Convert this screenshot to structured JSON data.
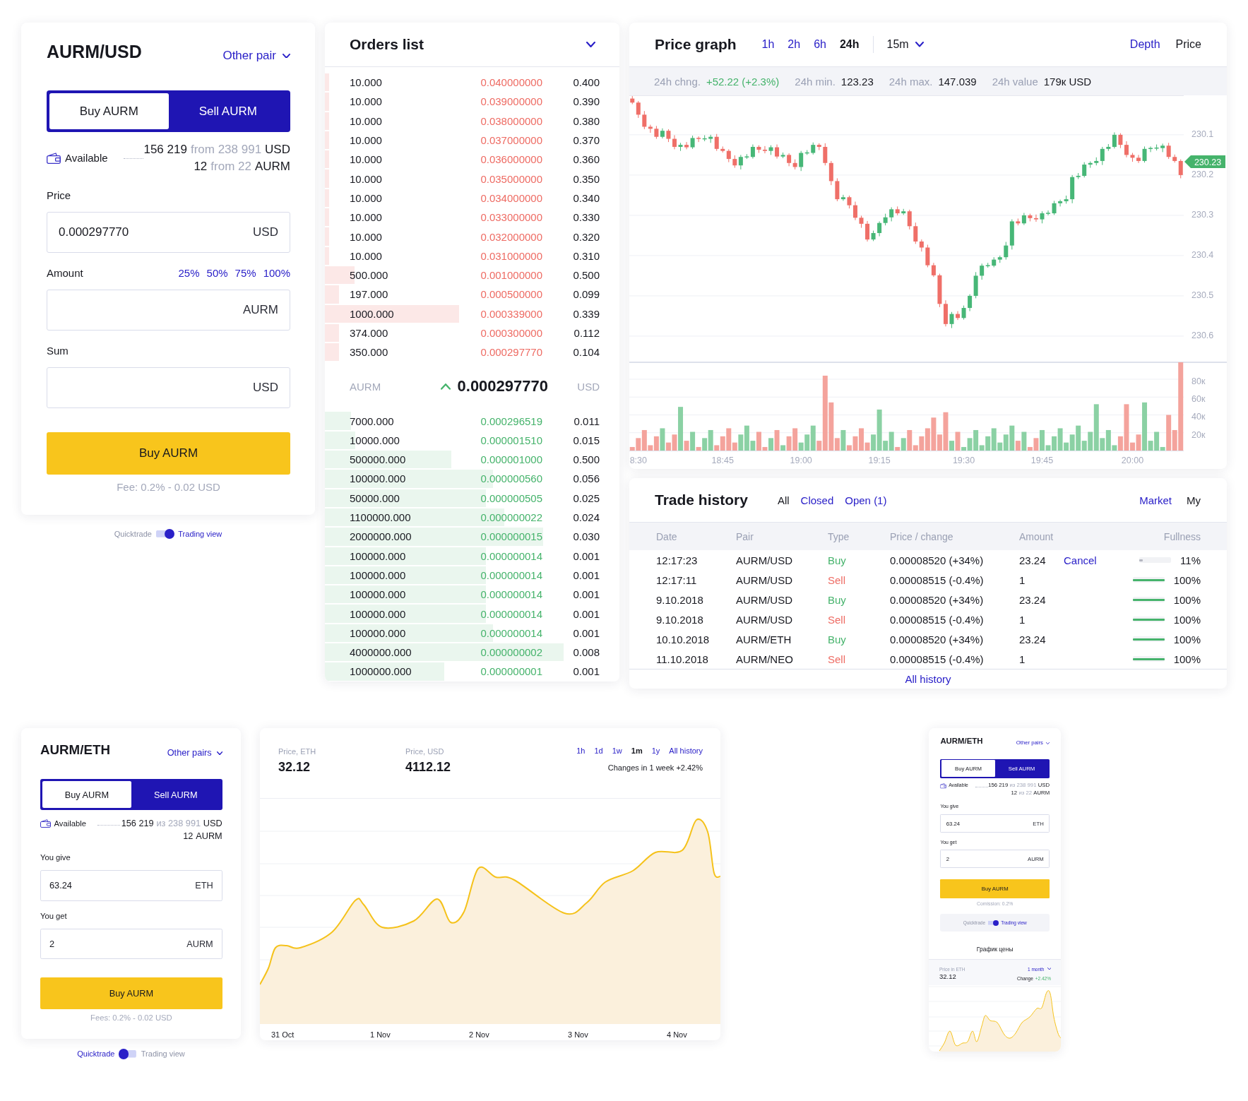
{
  "trade_panel": {
    "pair": "AURM/USD",
    "pair_menu": "Other pair",
    "tabs": [
      {
        "label": "Buy AURM",
        "selected": true
      },
      {
        "label": "Sell AURM",
        "selected": false
      }
    ],
    "available": {
      "label": "Available",
      "lines": [
        {
          "amount": "156 219",
          "of": "from 238 991",
          "unit": "USD"
        },
        {
          "amount": "12",
          "of": "from 22",
          "unit": "AURM"
        }
      ]
    },
    "fields": [
      {
        "label": "Price",
        "value": "0.000297770",
        "unit": "USD"
      },
      {
        "label": "Amount",
        "unit": "AURM",
        "shortcuts": [
          "25%",
          "50%",
          "75%",
          "100%"
        ]
      },
      {
        "label": "Sum",
        "unit": "USD"
      }
    ],
    "submit": "Buy AURM",
    "fee": "Fee: 0.2% - 0.02 USD"
  },
  "view_switch": {
    "left": "Quicktrade",
    "right": "Trading view",
    "on": true
  },
  "orders": {
    "title": "Orders list",
    "asks": [
      {
        "amount": "10.000",
        "price": "0.040000000",
        "total": "0.400",
        "level": 0.014
      },
      {
        "amount": "10.000",
        "price": "0.039000000",
        "total": "0.390",
        "level": 0.014
      },
      {
        "amount": "10.000",
        "price": "0.038000000",
        "total": "0.380",
        "level": 0.014
      },
      {
        "amount": "10.000",
        "price": "0.037000000",
        "total": "0.370",
        "level": 0.014
      },
      {
        "amount": "10.000",
        "price": "0.036000000",
        "total": "0.360",
        "level": 0.014
      },
      {
        "amount": "10.000",
        "price": "0.035000000",
        "total": "0.350",
        "level": 0.014
      },
      {
        "amount": "10.000",
        "price": "0.034000000",
        "total": "0.340",
        "level": 0.014
      },
      {
        "amount": "10.000",
        "price": "0.033000000",
        "total": "0.330",
        "level": 0.014
      },
      {
        "amount": "10.000",
        "price": "0.032000000",
        "total": "0.320",
        "level": 0.014
      },
      {
        "amount": "10.000",
        "price": "0.031000000",
        "total": "0.310",
        "level": 0.014
      },
      {
        "amount": "500.000",
        "price": "0.001000000",
        "total": "0.500",
        "level": 0.1
      },
      {
        "amount": "197.000",
        "price": "0.000500000",
        "total": "0.099",
        "level": 0.047
      },
      {
        "amount": "1000.000",
        "price": "0.000339000",
        "total": "0.339",
        "level": 0.456
      },
      {
        "amount": "374.000",
        "price": "0.000300000",
        "total": "0.112",
        "level": 0.047
      },
      {
        "amount": "350.000",
        "price": "0.000297770",
        "total": "0.104",
        "level": 0.047
      }
    ],
    "last": {
      "base": "AURM",
      "price": "0.000297770",
      "quote": "USD"
    },
    "bids": [
      {
        "amount": "7000.000",
        "price": "0.000296519",
        "total": "0.011",
        "level": 0.089
      },
      {
        "amount": "10000.000",
        "price": "0.000001510",
        "total": "0.015",
        "level": 0.103
      },
      {
        "amount": "500000.000",
        "price": "0.000001000",
        "total": "0.500",
        "level": 0.43
      },
      {
        "amount": "100000.000",
        "price": "0.000000560",
        "total": "0.056",
        "level": 0.57
      },
      {
        "amount": "50000.000",
        "price": "0.000000505",
        "total": "0.025",
        "level": 0.547
      },
      {
        "amount": "1100000.000",
        "price": "0.000000022",
        "total": "0.024",
        "level": 0.61
      },
      {
        "amount": "2000000.000",
        "price": "0.000000015",
        "total": "0.030",
        "level": 0.74
      },
      {
        "amount": "100000.000",
        "price": "0.000000014",
        "total": "0.001",
        "level": 0.547
      },
      {
        "amount": "100000.000",
        "price": "0.000000014",
        "total": "0.001",
        "level": 0.547
      },
      {
        "amount": "100000.000",
        "price": "0.000000014",
        "total": "0.001",
        "level": 0.547
      },
      {
        "amount": "100000.000",
        "price": "0.000000014",
        "total": "0.001",
        "level": 0.547
      },
      {
        "amount": "100000.000",
        "price": "0.000000014",
        "total": "0.001",
        "level": 0.57
      },
      {
        "amount": "4000000.000",
        "price": "0.000000002",
        "total": "0.008",
        "level": 0.81
      },
      {
        "amount": "1000000.000",
        "price": "0.000000001",
        "total": "0.001",
        "level": 0.405
      }
    ]
  },
  "price_graph": {
    "title": "Price graph",
    "ranges": [
      {
        "label": "1h",
        "selected": false
      },
      {
        "label": "2h",
        "selected": false
      },
      {
        "label": "6h",
        "selected": false
      },
      {
        "label": "24h",
        "selected": true
      }
    ],
    "interval": "15m",
    "views": [
      {
        "label": "Depth",
        "selected": false
      },
      {
        "label": "Price",
        "selected": true
      }
    ],
    "stats": [
      {
        "label": "24h chng.",
        "value": "+52.22 (+2.3%)",
        "kind": "positive"
      },
      {
        "label": "24h min.",
        "value": "123.23",
        "kind": "plain"
      },
      {
        "label": "24h max.",
        "value": "147.039",
        "kind": "plain"
      },
      {
        "label": "24h value",
        "value": "179к USD",
        "kind": "plain"
      }
    ],
    "last_price": "230.23",
    "candles": {
      "chart_data": {
        "type": "candlestick",
        "categories": [
          null,
          null,
          null,
          null,
          null,
          null,
          null,
          null,
          null,
          null,
          null,
          null,
          null,
          null,
          null,
          null,
          null,
          null,
          null,
          null,
          null,
          null,
          null,
          null,
          null,
          null,
          null,
          null,
          null,
          null,
          null,
          null,
          null,
          null,
          null,
          null,
          null,
          null,
          null,
          null,
          null,
          null,
          null,
          null,
          null,
          null,
          null,
          null,
          null,
          null,
          null,
          null,
          null,
          null,
          null,
          null,
          null,
          null,
          null,
          null,
          null,
          null,
          null,
          null,
          null,
          null,
          null,
          null,
          null,
          null,
          null,
          null,
          null,
          null,
          null,
          null,
          null,
          null,
          null,
          null,
          null,
          null,
          null,
          null,
          null,
          null,
          null,
          null,
          null,
          null,
          null,
          null
        ],
        "ohlc": [
          [
            230.01,
            230.024,
            230.004,
            230.02
          ],
          [
            230.02,
            230.058,
            230.016,
            230.05
          ],
          [
            230.05,
            230.086,
            230.041,
            230.08
          ],
          [
            230.08,
            230.095,
            230.075,
            230.085
          ],
          [
            230.085,
            230.11,
            230.078,
            230.105
          ],
          [
            230.105,
            230.109,
            230.084,
            230.09
          ],
          [
            230.09,
            230.118,
            230.086,
            230.11
          ],
          [
            230.11,
            230.136,
            230.101,
            230.13
          ],
          [
            230.13,
            230.14,
            230.12,
            230.125
          ],
          [
            230.125,
            230.136,
            230.118,
            230.131
          ],
          [
            230.131,
            230.135,
            230.102,
            230.108
          ],
          [
            230.108,
            230.118,
            230.104,
            230.11
          ],
          [
            230.11,
            230.116,
            230.101,
            230.11
          ],
          [
            230.11,
            230.12,
            230.1,
            230.105
          ],
          [
            230.105,
            230.14,
            230.098,
            230.135
          ],
          [
            230.135,
            230.144,
            230.129,
            230.14
          ],
          [
            230.14,
            230.168,
            230.136,
            230.16
          ],
          [
            230.16,
            230.182,
            230.151,
            230.176
          ],
          [
            230.176,
            230.186,
            230.15,
            230.155
          ],
          [
            230.155,
            230.16,
            230.148,
            230.155
          ],
          [
            230.155,
            230.159,
            230.124,
            230.13
          ],
          [
            230.13,
            230.145,
            230.126,
            230.137
          ],
          [
            230.137,
            230.146,
            230.128,
            230.14
          ],
          [
            230.14,
            230.15,
            230.126,
            230.131
          ],
          [
            230.131,
            230.159,
            230.124,
            230.154
          ],
          [
            230.154,
            230.158,
            230.144,
            230.15
          ],
          [
            230.15,
            230.178,
            230.146,
            230.17
          ],
          [
            230.17,
            230.186,
            230.161,
            230.18
          ],
          [
            230.18,
            230.19,
            230.14,
            230.145
          ],
          [
            230.145,
            230.15,
            230.138,
            230.145
          ],
          [
            230.145,
            230.149,
            230.119,
            230.125
          ],
          [
            230.125,
            230.138,
            230.121,
            230.13
          ],
          [
            230.13,
            230.176,
            230.121,
            230.17
          ],
          [
            230.17,
            230.225,
            230.165,
            230.215
          ],
          [
            230.215,
            230.265,
            230.208,
            230.26
          ],
          [
            230.26,
            230.264,
            230.249,
            230.255
          ],
          [
            230.255,
            230.283,
            230.251,
            230.275
          ],
          [
            230.275,
            230.312,
            230.266,
            230.306
          ],
          [
            230.306,
            230.331,
            230.301,
            230.321
          ],
          [
            230.321,
            230.365,
            230.314,
            230.36
          ],
          [
            230.36,
            230.364,
            230.338,
            230.344
          ],
          [
            230.344,
            230.352,
            230.315,
            230.319
          ],
          [
            230.319,
            230.325,
            230.296,
            230.305
          ],
          [
            230.305,
            230.315,
            230.28,
            230.285
          ],
          [
            230.285,
            230.3,
            230.278,
            230.295
          ],
          [
            230.295,
            230.299,
            230.284,
            230.29
          ],
          [
            230.29,
            230.335,
            230.286,
            230.327
          ],
          [
            230.327,
            230.371,
            230.318,
            230.365
          ],
          [
            230.365,
            230.39,
            230.36,
            230.38
          ],
          [
            230.38,
            230.429,
            230.373,
            230.424
          ],
          [
            230.424,
            230.453,
            230.418,
            230.449
          ],
          [
            230.449,
            230.528,
            230.445,
            230.52
          ],
          [
            230.52,
            230.576,
            230.511,
            230.57
          ],
          [
            230.57,
            230.58,
            230.54,
            230.545
          ],
          [
            230.545,
            230.56,
            230.538,
            230.555
          ],
          [
            230.555,
            230.559,
            230.524,
            230.53
          ],
          [
            230.53,
            230.538,
            230.496,
            230.5
          ],
          [
            230.5,
            230.506,
            230.441,
            230.45
          ],
          [
            230.45,
            230.46,
            230.42,
            230.425
          ],
          [
            230.425,
            230.43,
            230.418,
            230.425
          ],
          [
            230.425,
            230.429,
            230.404,
            230.41
          ],
          [
            230.41,
            230.418,
            230.4,
            230.404
          ],
          [
            230.404,
            230.41,
            230.366,
            230.375
          ],
          [
            230.375,
            230.385,
            230.31,
            230.315
          ],
          [
            230.315,
            230.325,
            230.308,
            230.32
          ],
          [
            230.32,
            230.324,
            230.294,
            230.3
          ],
          [
            230.3,
            230.315,
            230.296,
            230.307
          ],
          [
            230.307,
            230.316,
            230.298,
            230.31
          ],
          [
            230.31,
            230.32,
            230.29,
            230.295
          ],
          [
            230.295,
            230.3,
            230.288,
            230.295
          ],
          [
            230.295,
            230.299,
            230.264,
            230.27
          ],
          [
            230.27,
            230.278,
            230.261,
            230.265
          ],
          [
            230.265,
            230.271,
            230.251,
            230.26
          ],
          [
            230.26,
            230.27,
            230.2,
            230.205
          ],
          [
            230.205,
            230.21,
            230.195,
            230.202
          ],
          [
            230.202,
            230.206,
            230.168,
            230.174
          ],
          [
            230.174,
            230.182,
            230.166,
            230.17
          ],
          [
            230.17,
            230.176,
            230.156,
            230.165
          ],
          [
            230.165,
            230.175,
            230.13,
            230.135
          ],
          [
            230.135,
            230.14,
            230.123,
            230.13
          ],
          [
            230.13,
            230.134,
            230.094,
            230.1
          ],
          [
            230.1,
            230.133,
            230.096,
            230.125
          ],
          [
            230.125,
            230.156,
            230.116,
            230.15
          ],
          [
            230.15,
            230.167,
            230.145,
            230.157
          ],
          [
            230.157,
            230.17,
            230.15,
            230.165
          ],
          [
            230.165,
            230.169,
            230.129,
            230.135
          ],
          [
            230.135,
            230.143,
            230.129,
            230.133
          ],
          [
            230.133,
            230.139,
            230.124,
            230.133
          ],
          [
            230.133,
            230.143,
            230.122,
            230.127
          ],
          [
            230.127,
            230.16,
            230.12,
            230.155
          ],
          [
            230.155,
            230.169,
            230.149,
            230.165
          ],
          [
            230.165,
            230.208,
            230.161,
            230.2
          ]
        ],
        "ylim": [
          230.665,
          230.002
        ],
        "yticks": [
          230.1,
          230.2,
          230.3,
          230.4,
          230.5,
          230.6
        ],
        "grid": true
      }
    },
    "volume": {
      "chart_data": {
        "type": "bar",
        "categories": [
          null,
          "8:30",
          null,
          null,
          null,
          null,
          null,
          null,
          null,
          null,
          null,
          null,
          null,
          null,
          null,
          "18:45",
          null,
          null,
          null,
          null,
          null,
          null,
          null,
          null,
          null,
          null,
          null,
          null,
          "19:00",
          null,
          null,
          null,
          null,
          null,
          null,
          null,
          null,
          null,
          null,
          null,
          null,
          "19:15",
          null,
          null,
          null,
          null,
          null,
          null,
          null,
          null,
          null,
          null,
          null,
          null,
          null,
          "19:30",
          null,
          null,
          null,
          null,
          null,
          null,
          null,
          null,
          null,
          null,
          null,
          null,
          "19:45",
          null,
          null,
          null,
          null,
          null,
          null,
          null,
          null,
          null,
          null,
          null,
          null,
          null,
          null,
          "20:00",
          null,
          null,
          null,
          null,
          null,
          null,
          null,
          null
        ],
        "values": [
          4,
          14,
          23,
          6,
          16,
          25,
          9,
          18,
          49,
          11,
          21,
          4,
          14,
          23,
          6,
          16,
          25,
          9,
          18,
          28,
          11,
          21,
          4,
          14,
          23,
          6,
          16,
          25,
          9,
          18,
          28,
          11,
          84,
          54,
          14,
          23,
          6,
          16,
          25,
          9,
          18,
          46,
          11,
          21,
          4,
          14,
          23,
          6,
          16,
          25,
          37,
          18,
          43,
          11,
          21,
          4,
          14,
          23,
          6,
          16,
          25,
          9,
          18,
          28,
          11,
          21,
          4,
          14,
          23,
          6,
          16,
          25,
          9,
          18,
          28,
          11,
          21,
          52,
          14,
          23,
          6,
          16,
          52,
          9,
          18,
          54,
          11,
          21,
          4,
          40,
          23,
          99
        ],
        "ylim": [
          0,
          99
        ],
        "yticks": [
          {
            "value": 80,
            "label": "80к"
          },
          {
            "value": 60,
            "label": "60к"
          },
          {
            "value": 40,
            "label": "40к"
          },
          {
            "value": 20,
            "label": "20к"
          }
        ],
        "grid": true
      }
    }
  },
  "trade_history": {
    "title": "Trade history",
    "filters": [
      {
        "label": "All",
        "selected": true
      },
      {
        "label": "Closed",
        "selected": false
      },
      {
        "label": "Open (1)",
        "selected": false
      }
    ],
    "scopes": [
      {
        "label": "Market",
        "selected": false
      },
      {
        "label": "My",
        "selected": true
      }
    ],
    "columns": [
      "Date",
      "Pair",
      "Type",
      "Price / change",
      "Amount",
      "Fullness"
    ],
    "rows": [
      {
        "date": "12:17:23",
        "pair": "AURM/USD",
        "type": "Buy",
        "kind": "buy",
        "price": "0.00008520 (+34%)",
        "amount": "23.24",
        "action": "Cancel",
        "level": 0.11,
        "filled": false,
        "fullness": "11%"
      },
      {
        "date": "12:17:11",
        "pair": "AURM/USD",
        "type": "Sell",
        "kind": "sell",
        "price": "0.00008515 (-0.4%)",
        "amount": "1",
        "level": 1,
        "filled": true,
        "fullness": "100%"
      },
      {
        "date": "9.10.2018",
        "pair": "AURM/USD",
        "type": "Buy",
        "kind": "buy",
        "price": "0.00008520 (+34%)",
        "amount": "23.24",
        "level": 1,
        "filled": true,
        "fullness": "100%"
      },
      {
        "date": "9.10.2018",
        "pair": "AURM/USD",
        "type": "Sell",
        "kind": "sell",
        "price": "0.00008515 (-0.4%)",
        "amount": "1",
        "level": 1,
        "filled": true,
        "fullness": "100%"
      },
      {
        "date": "10.10.2018",
        "pair": "AURM/ETH",
        "type": "Buy",
        "kind": "buy",
        "price": "0.00008520 (+34%)",
        "amount": "23.24",
        "level": 1,
        "filled": true,
        "fullness": "100%"
      },
      {
        "date": "11.10.2018",
        "pair": "AURM/NEO",
        "type": "Sell",
        "kind": "sell",
        "price": "0.00008515 (-0.4%)",
        "amount": "1",
        "level": 1,
        "filled": true,
        "fullness": "100%"
      }
    ],
    "footer_link": "All history"
  },
  "quick_trade": {
    "pair": "AURM/ETH",
    "pair_menu": "Other pairs",
    "tabs": [
      {
        "label": "Buy AURM",
        "selected": true
      },
      {
        "label": "Sell AURM",
        "selected": false
      }
    ],
    "available": {
      "label": "Available",
      "lines": [
        {
          "amount": "156 219",
          "of": "из 238 991",
          "unit": "USD"
        },
        {
          "amount": "12",
          "unit": "AURM"
        }
      ]
    },
    "fields": [
      {
        "label": "You give",
        "value": "63.24",
        "unit": "ETH"
      },
      {
        "label": "You get",
        "value": "2",
        "unit": "AURM"
      }
    ],
    "submit": "Buy AURM",
    "fee": "Fees: 0.2% - 0.02 USD"
  },
  "quick_switch": {
    "left": "Quicktrade",
    "right": "Trading view",
    "on": false
  },
  "price_chart": {
    "prices": [
      {
        "label": "Price, ETH",
        "value": "32.12"
      },
      {
        "label": "Price, USD",
        "value": "4112.12"
      }
    ],
    "ranges": [
      {
        "label": "1h",
        "selected": false
      },
      {
        "label": "1d",
        "selected": false
      },
      {
        "label": "1w",
        "selected": false
      },
      {
        "label": "1m",
        "selected": true
      },
      {
        "label": "1y",
        "selected": false
      },
      {
        "label": "All history",
        "selected": false
      }
    ],
    "change": "Changes in 1 week +2.42%",
    "dates": [
      "31 Oct",
      "1 Nov",
      "2 Nov",
      "3 Nov",
      "4 Nov"
    ]
  },
  "mobile_widget": {
    "pair": "AURM/ETH",
    "pair_menu": "Other pairs",
    "tabs": [
      {
        "label": "Buy AURM",
        "selected": true
      },
      {
        "label": "Sell AURM",
        "selected": false
      }
    ],
    "available": {
      "label": "Available",
      "lines": [
        {
          "amount": "156 219",
          "of": "из 238 991",
          "unit": "USD"
        },
        {
          "amount": "12",
          "of": "из 22",
          "unit": "AURM"
        }
      ]
    },
    "fields": [
      {
        "label": "You give",
        "value": "63.24",
        "unit": "ETH"
      },
      {
        "label": "You get",
        "value": "2",
        "unit": "AURM"
      }
    ],
    "submit": "Buy AURM",
    "fee": "Comission: 0.2%",
    "switch": {
      "left": "Quicktrade",
      "right": "Trading view",
      "on": true
    },
    "chart_title": "График цены",
    "price_label": "Price in ETH",
    "price": "32.12",
    "range": "1 month",
    "change_label": "Change",
    "change": "+2.42%"
  }
}
